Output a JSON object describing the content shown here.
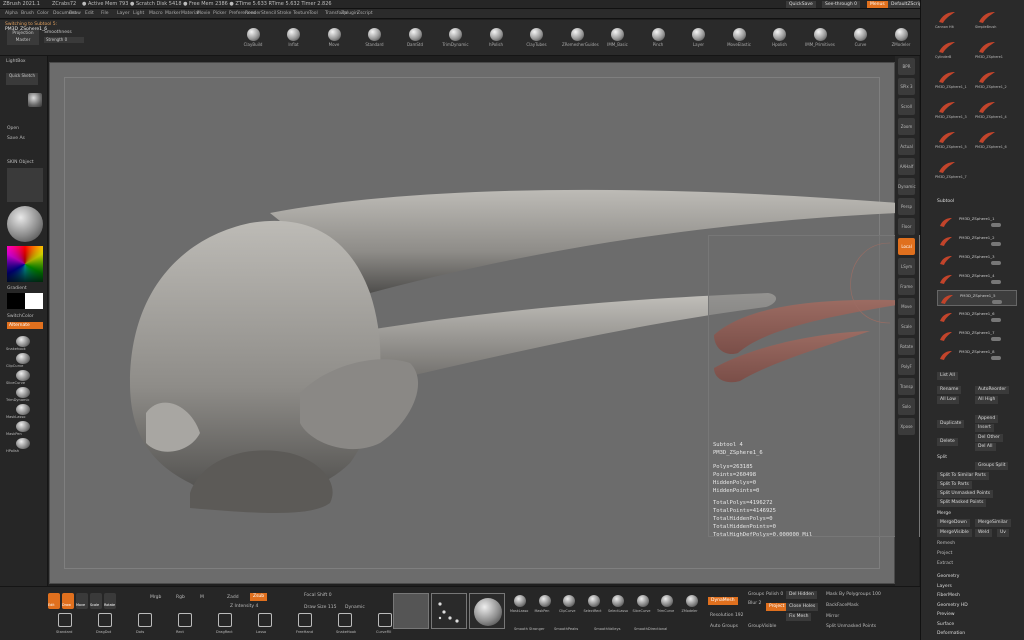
{
  "title_bar": {
    "app": "ZBrush 2021.1",
    "project": "ZCrabs72",
    "stats": "● Active Mem 793 ● Scratch Disk 5418 ● Free Mem 2386 ● ZTime 5.633 RTime 5.632 Timer 2.826"
  },
  "menu": [
    "Alpha",
    "Brush",
    "Color",
    "Document",
    "Draw",
    "Edit",
    "File",
    "Layer",
    "Light",
    "Macro",
    "Marker",
    "Material",
    "Movie",
    "Picker",
    "Preferences",
    "Render",
    "Stencil",
    "Stroke",
    "Texture",
    "Tool",
    "Transform",
    "Zplugin",
    "Zscript"
  ],
  "top_right": {
    "quicksave": "QuickSave",
    "see_through": "See-through 0",
    "menus": "Menus",
    "default_script": "DefaultZScript"
  },
  "brush_panel": {
    "switching_label": "Switching to Subtool 5:",
    "switching_name": "PM3D_ZSphere1_6",
    "projection_master": "Projection Master",
    "lightbox_label": "LightBox",
    "quick_sketch": "Quick Sketch",
    "smoothness": "Smoothness",
    "strength": "Strength 0"
  },
  "brushes": [
    "ClayBuild",
    "Inflat",
    "Move",
    "Standard",
    "DamStd",
    "TrimDynamic",
    "hPolish",
    "ClayTubes",
    "ZRemesherGuides",
    "IMM_Basic",
    "Pinch",
    "Layer",
    "MoveElastic",
    "Hpolish",
    "IMM_Primitives",
    "Curve",
    "ZModeler"
  ],
  "left_panel": {
    "lightbox": "LightBox",
    "quick_sketch": "Quick Sketch",
    "open": "Open",
    "save_as": "Save As",
    "material": "SKIN Object",
    "gradient": "Gradient",
    "switch_color": "SwitchColor",
    "alternate": "Alternate",
    "tools": [
      "Snakehook",
      "ClipCurve",
      "SliceCurve",
      "TrimDynamic",
      "MaskLasso",
      "MaskPen",
      "HPolish"
    ]
  },
  "info_overlay": {
    "subtool": "Subtool 4",
    "name": "PM3D_ZSphere1_6",
    "polys": "Polys=263185",
    "points": "Points=260498",
    "hidden_polys": "HiddenPolys=0",
    "hidden_points": "HiddenPoints=0",
    "total_polys": "TotalPolys=4196272",
    "total_points": "TotalPoints=4146925",
    "total_hidden_polys": "TotalHiddenPolys=0",
    "total_hidden_points": "TotalHiddenPoints=0",
    "total_high_def": "TotalHighDefPolys=0.000000 Mil"
  },
  "right_shelf": [
    "BPR",
    "SPix 3",
    "Scroll",
    "Zoom",
    "Actual",
    "AAHalf",
    "Dynamic",
    "Persp",
    "Floor",
    "Local",
    "LSym",
    "Frame",
    "Move",
    "Scale",
    "Rotate",
    "PolyF",
    "Transp",
    "Solo",
    "Xpose"
  ],
  "palette": {
    "tools": [
      "Cannon Hit",
      "SimpleBrush",
      "CylinderB",
      "PM3D_ZSphere1",
      "PM3D_ZSphere1_1",
      "PM3D_ZSphere1_2",
      "PM3D_ZSphere1_3",
      "PM3D_ZSphere1_4",
      "PM3D_ZSphere1_5",
      "PM3D_ZSphere1_6",
      "PM3D_ZSphere1_7"
    ],
    "subtool_header": "Subtool",
    "subtools": [
      "PM3D_ZSphere1_1",
      "PM3D_ZSphere1_2",
      "PM3D_ZSphere1_3",
      "PM3D_ZSphere1_4",
      "PM3D_ZSphere1_5",
      "PM3D_ZSphere1_6",
      "PM3D_ZSphere1_7",
      "PM3D_ZSphere1_8"
    ],
    "list_all": "List All",
    "rename": "Rename",
    "autoreorder": "AutoReorder",
    "all_low": "All Low",
    "all_high": "All High",
    "duplicate": "Duplicate",
    "append": "Append",
    "insert": "Insert",
    "delete": "Delete",
    "del_other": "Del Other",
    "del_all": "Del All",
    "split_header": "Split",
    "groups_split": "Groups Split",
    "split_similar": "Split To Similar Parts",
    "split_parts": "Split To Parts",
    "split_unmasked": "Split Unmasked Points",
    "split_masked": "Split Masked Points",
    "merge_header": "Merge",
    "merge_down": "MergeDown",
    "merge_similar": "MergeSimilar",
    "merge_visible": "MergeVisible",
    "weld": "Weld",
    "uv": "Uv",
    "remesh": "Remesh",
    "project": "Project",
    "extract": "Extract",
    "sections": [
      "Geometry",
      "Layers",
      "FiberMesh",
      "Geometry HD",
      "Preview",
      "Surface",
      "Deformation"
    ]
  },
  "bottom_bar": {
    "modes": [
      "Edit",
      "Draw",
      "Move",
      "Scale",
      "Rotate"
    ],
    "mrgb": "Mrgb",
    "rgb": "Rgb",
    "m": "M",
    "zadd": "Zadd",
    "zsub": "Zsub",
    "z_intensity": "Z Intensity 4",
    "focal_shift": "Focal Shift 0",
    "draw_size": "Draw Size 115",
    "dynamic": "Dynamic",
    "tools": [
      "Standard",
      "DragDot",
      "Dots",
      "Rect",
      "DragRect",
      "Lasso",
      "FreeHand",
      "SnakeHook",
      "CurveFill"
    ],
    "brushes_lower": [
      "MaskLasso",
      "MaskPen",
      "ClipCurve",
      "SelectRect",
      "SelectLasso",
      "SliceCurve",
      "TrimCurve",
      "ZModeler"
    ],
    "extra": [
      "Smooth Stronger",
      "SmoothPeaks",
      "SmoothValleys",
      "SmoothDirectional"
    ],
    "dynamesh": "DynaMesh",
    "groups": "Groups",
    "polish": "Polish 0",
    "blur": "Blur 2",
    "del_hidden": "Del Hidden",
    "mask_by_polygroups": "Mask By Polygroups 100",
    "project": "Project",
    "close_holes": "Close Holes",
    "backface_mask": "BackFaceMask",
    "resolution": "Resolution 192",
    "fix_mesh": "Fix Mesh",
    "mirror": "Mirror",
    "auto_groups": "Auto Groups",
    "group_visible": "GroupVisible",
    "split_unmasked": "Split Unmasked Points"
  }
}
